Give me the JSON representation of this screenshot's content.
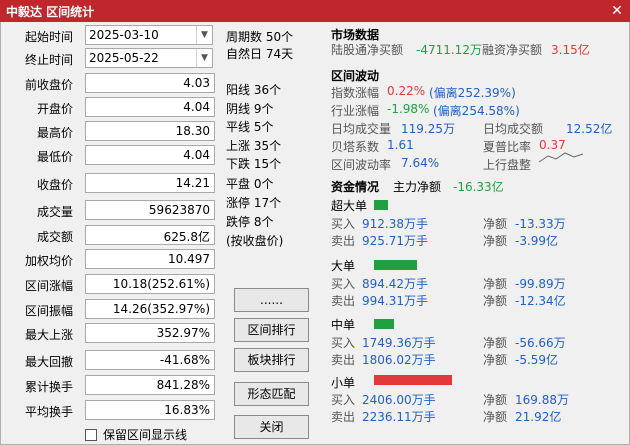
{
  "window": {
    "title": "中毅达  区间统计",
    "close_glyph": "✕"
  },
  "left": {
    "start": {
      "label": "起始时间",
      "value": "2025-03-10"
    },
    "end": {
      "label": "终止时间",
      "value": "2025-05-22"
    },
    "rows": [
      {
        "label": "前收盘价",
        "value": "4.03"
      },
      {
        "label": "开盘价",
        "value": "4.04"
      },
      {
        "label": "最高价",
        "value": "18.30"
      },
      {
        "label": "最低价",
        "value": "4.04"
      },
      {
        "label": "收盘价",
        "value": "14.21"
      },
      {
        "label": "成交量",
        "value": "59623870"
      },
      {
        "label": "成交额",
        "value": "625.8亿"
      },
      {
        "label": "加权均价",
        "value": "10.497"
      },
      {
        "label": "区间涨幅",
        "value": "10.18(252.61%)"
      },
      {
        "label": "区间振幅",
        "value": "14.26(352.97%)"
      },
      {
        "label": "最大上涨",
        "value": "352.97%"
      },
      {
        "label": "最大回撤",
        "value": "-41.68%"
      },
      {
        "label": "累计换手",
        "value": "841.28%"
      },
      {
        "label": "平均换手",
        "value": "16.83%"
      }
    ],
    "checkbox_label": "保留区间显示线"
  },
  "middle": {
    "lines": [
      "周期数 50个",
      "自然日 74天",
      "阳线 36个",
      "阴线 9个",
      "平线 5个",
      "上涨 35个",
      "下跌 15个",
      "平盘 0个",
      "涨停 17个",
      "跌停 8个",
      "(按收盘价)"
    ],
    "buttons": [
      "......",
      "区间排行",
      "板块排行",
      "形态匹配",
      "关闭"
    ]
  },
  "market": {
    "title": "市场数据",
    "hk_label": "陆股通净买额",
    "hk_value": "-4711.12万",
    "margin_label": "融资净买额",
    "margin_value": "3.15亿"
  },
  "volatility": {
    "title": "区间波动",
    "index_label": "指数涨幅",
    "index_value": "0.22%",
    "index_dev": "(偏离252.39%)",
    "industry_label": "行业涨幅",
    "industry_value": "-1.98%",
    "industry_dev": "(偏离254.58%)",
    "avg_vol_label": "日均成交量",
    "avg_vol_value": "119.25万",
    "avg_amt_label": "日均成交额",
    "avg_amt_value": "12.52亿",
    "beta_label": "贝塔系数",
    "beta_value": "1.61",
    "sharpe_label": "夏普比率",
    "sharpe_value": "0.37",
    "volrate_label": "区间波动率",
    "volrate_value": "7.64%",
    "trend_label": "上行盘整"
  },
  "funds": {
    "title": "资金情况",
    "main_label": "主力净额",
    "main_value": "-16.33亿",
    "groups": [
      {
        "name": "超大单",
        "buy": "912.38万手",
        "sell": "925.71万手",
        "net_buy": "-13.33万",
        "net_sell": "-3.99亿",
        "bar_color": "#20a040",
        "bar_scale": 0.18
      },
      {
        "name": "大单",
        "buy": "894.42万手",
        "sell": "994.31万手",
        "net_buy": "-99.89万",
        "net_sell": "-12.34亿",
        "bar_color": "#20a040",
        "bar_scale": 0.55
      },
      {
        "name": "中单",
        "buy": "1749.36万手",
        "sell": "1806.02万手",
        "net_buy": "-56.66万",
        "net_sell": "-5.59亿",
        "bar_color": "#20a040",
        "bar_scale": 0.25
      },
      {
        "name": "小单",
        "buy": "2406.00万手",
        "sell": "2236.11万手",
        "net_buy": "169.88万",
        "net_sell": "21.92亿",
        "bar_color": "#e23a3a",
        "bar_scale": 1.0
      }
    ],
    "buy_label": "买入",
    "sell_label": "卖出",
    "net_label": "净额"
  }
}
